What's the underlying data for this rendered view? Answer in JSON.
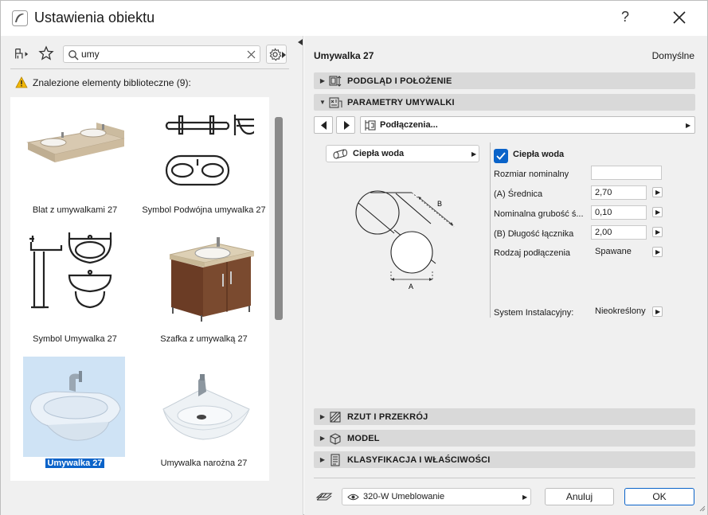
{
  "title": "Ustawienia obiektu",
  "help_label": "?",
  "search": {
    "value": "umy"
  },
  "found_label": "Znalezione elementy biblioteczne (9):",
  "library": [
    {
      "label": "Blat z umywalkami 27"
    },
    {
      "label": "Symbol Podwójna umywalka 27"
    },
    {
      "label": "Symbol Umywalka 27"
    },
    {
      "label": "Szafka z umywalką 27"
    },
    {
      "label": "Umywalka 27",
      "selected": true
    },
    {
      "label": "Umywalka narożna 27"
    }
  ],
  "right": {
    "object_name": "Umywalka 27",
    "defaults_label": "Domyślne",
    "sections": {
      "preview": "PODGLĄD I POŁOŻENIE",
      "params": "PARAMETRY UMYWALKI",
      "floorplan": "RZUT I PRZEKRÓJ",
      "model": "MODEL",
      "classification": "KLASYFIKACJA I WŁAŚCIWOŚCI"
    },
    "page_selector": "Podłączenia...",
    "water_button": "Ciepła woda",
    "checkbox_label": "Ciepła woda",
    "diagram": {
      "label_a": "A",
      "label_b": "B"
    },
    "params": [
      {
        "label": "Rozmiar nominalny",
        "value": ""
      },
      {
        "label": "(A) Średnica",
        "value": "2,70"
      },
      {
        "label": "Nominalna grubość ś...",
        "value": "0,10"
      },
      {
        "label": "(B) Długość łącznika",
        "value": "2,00"
      },
      {
        "label": "Rodzaj podłączenia",
        "value": "Spawane"
      },
      {
        "label": "System Instalacyjny:",
        "value": "Nieokreślony"
      }
    ],
    "layer": "320-W Umeblowanie",
    "cancel_label": "Anuluj",
    "ok_label": "OK"
  },
  "colors": {
    "accent": "#0a63c9",
    "selected_bg": "#cfe3f5",
    "section_bg": "#d9d9d9"
  }
}
